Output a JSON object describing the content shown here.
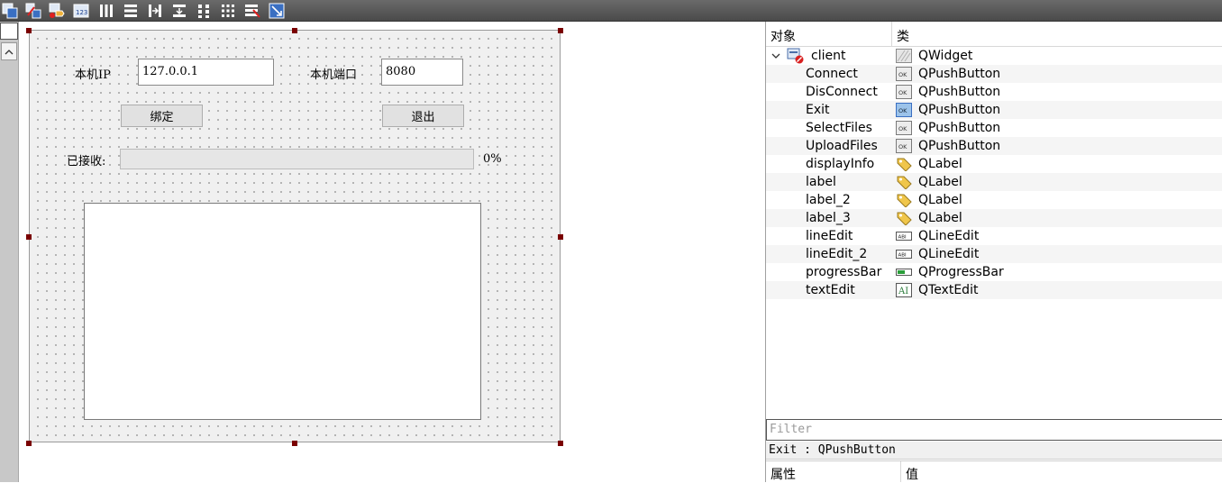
{
  "toolbar": {
    "icons": [
      "edit-widgets-icon",
      "edit-signals-slots-icon",
      "edit-buddies-icon",
      "edit-tab-order-icon",
      "layout-horizontal-icon",
      "layout-vertical-icon",
      "layout-horizontal-splitter-icon",
      "layout-vertical-splitter-icon",
      "layout-form-icon",
      "layout-grid-icon",
      "break-layout-icon",
      "adjust-size-icon"
    ]
  },
  "form": {
    "local_ip_label": "本机IP",
    "local_ip_value": "127.0.0.1",
    "local_port_label": "本机端口",
    "local_port_value": "8080",
    "bind_button": "绑定",
    "exit_button": "退出",
    "received_label": "已接收:",
    "progress_text": "0%",
    "progress_value": 0
  },
  "inspector": {
    "col_object": "对象",
    "col_class": "类",
    "root": {
      "name": "client",
      "class": "QWidget",
      "icon": "qwidget-icon"
    },
    "items": [
      {
        "name": "Connect",
        "class": "QPushButton",
        "icon": "pushbutton-icon"
      },
      {
        "name": "DisConnect",
        "class": "QPushButton",
        "icon": "pushbutton-icon"
      },
      {
        "name": "Exit",
        "class": "QPushButton",
        "icon": "pushbutton-selected-icon"
      },
      {
        "name": "SelectFiles",
        "class": "QPushButton",
        "icon": "pushbutton-icon"
      },
      {
        "name": "UploadFiles",
        "class": "QPushButton",
        "icon": "pushbutton-icon"
      },
      {
        "name": "displayInfo",
        "class": "QLabel",
        "icon": "label-tag-icon"
      },
      {
        "name": "label",
        "class": "QLabel",
        "icon": "label-tag-icon"
      },
      {
        "name": "label_2",
        "class": "QLabel",
        "icon": "label-tag-icon"
      },
      {
        "name": "label_3",
        "class": "QLabel",
        "icon": "label-tag-icon"
      },
      {
        "name": "lineEdit",
        "class": "QLineEdit",
        "icon": "lineedit-icon"
      },
      {
        "name": "lineEdit_2",
        "class": "QLineEdit",
        "icon": "lineedit-icon"
      },
      {
        "name": "progressBar",
        "class": "QProgressBar",
        "icon": "progressbar-icon"
      },
      {
        "name": "textEdit",
        "class": "QTextEdit",
        "icon": "textedit-icon"
      }
    ],
    "filter_placeholder": "Filter",
    "selection_info": "Exit : QPushButton"
  },
  "property_editor": {
    "col_property": "属性",
    "col_value": "值"
  }
}
